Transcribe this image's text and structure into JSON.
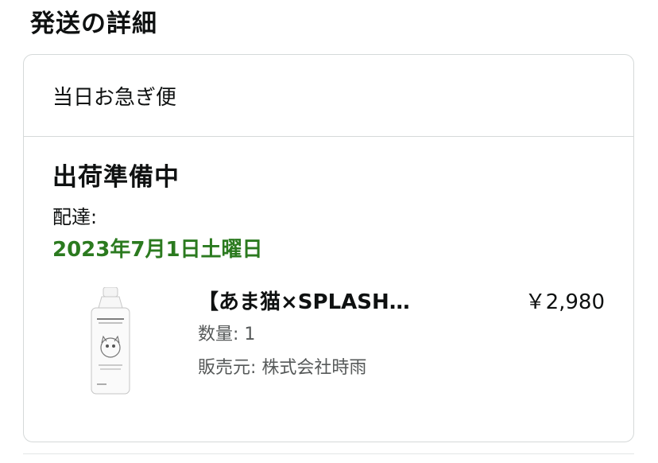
{
  "section_title": "発送の詳細",
  "card": {
    "shipping_speed": "当日お急ぎ便",
    "status": "出荷準備中",
    "delivery_label": "配達:",
    "delivery_date": "2023年7月1日土曜日"
  },
  "item": {
    "title": "【あま猫×SPLASH…",
    "price": "￥2,980",
    "quantity": "数量: 1",
    "seller": "販売元: 株式会社時雨",
    "image_icon": "product-bottle-icon"
  },
  "colors": {
    "delivery_date": "#2b7a1f",
    "border": "#d5d9d9",
    "secondary_text": "#565959"
  }
}
